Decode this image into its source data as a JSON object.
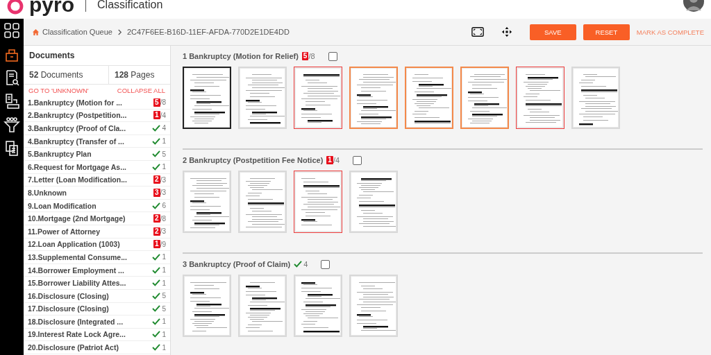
{
  "header": {
    "logo": "pyro",
    "title": "Classification"
  },
  "nav": [
    {
      "selected": false
    },
    {
      "selected": true
    },
    {
      "selected": false
    },
    {
      "selected": false
    },
    {
      "selected": false
    },
    {
      "selected": false
    }
  ],
  "breadcrumb": {
    "root": "Classification Queue",
    "current": "2C47F6EE-B16D-11EF-AFDA-770D2E1DE4DD"
  },
  "toolbar": {
    "buttons": [
      "SAVE",
      "RESET"
    ],
    "link": "MARK AS COMPLETE"
  },
  "sidebar": {
    "title": "Documents",
    "documents_count": "52",
    "documents_label": "Documents",
    "pages_count": "128",
    "pages_label": "Pages",
    "goto": "GO TO 'UNKNOWN'",
    "collapse": "COLLAPSE ALL",
    "items": [
      {
        "label": "1.Bankruptcy (Motion for ...",
        "kind": "flagged",
        "flag": "5",
        "count": "/8"
      },
      {
        "label": "2.Bankruptcy (Postpetition...",
        "kind": "flagged",
        "flag": "1",
        "count": "/4"
      },
      {
        "label": "3.Bankruptcy (Proof of Cla...",
        "kind": "done",
        "count": "4"
      },
      {
        "label": "4.Bankruptcy (Transfer of ...",
        "kind": "done",
        "count": "1"
      },
      {
        "label": "5.Bankruptcy Plan",
        "kind": "done",
        "count": "5"
      },
      {
        "label": "6.Request for Mortgage As...",
        "kind": "done",
        "count": "1"
      },
      {
        "label": "7.Letter (Loan Modification...",
        "kind": "flagged",
        "flag": "2",
        "count": "/3"
      },
      {
        "label": "8.Unknown",
        "kind": "flagged",
        "flag": "3",
        "count": "/3"
      },
      {
        "label": "9.Loan Modification",
        "kind": "done",
        "count": "6"
      },
      {
        "label": "10.Mortgage (2nd Mortgage)",
        "kind": "flagged",
        "flag": "2",
        "count": "/8"
      },
      {
        "label": "11.Power of Attorney",
        "kind": "flagged",
        "flag": "2",
        "count": "/3"
      },
      {
        "label": "12.Loan Application (1003)",
        "kind": "flagged",
        "flag": "1",
        "count": "/9"
      },
      {
        "label": "13.Supplemental Consume...",
        "kind": "done",
        "count": "1"
      },
      {
        "label": "14.Borrower Employment ...",
        "kind": "done",
        "count": "1"
      },
      {
        "label": "15.Borrower Liability Attes...",
        "kind": "done",
        "count": "1"
      },
      {
        "label": "16.Disclosure (Closing)",
        "kind": "done",
        "count": "5"
      },
      {
        "label": "17.Disclosure (Closing)",
        "kind": "done",
        "count": "5"
      },
      {
        "label": "18.Disclosure (Integrated ...",
        "kind": "done",
        "count": "1"
      },
      {
        "label": "19.Interest Rate Lock Agre...",
        "kind": "done",
        "count": "1"
      },
      {
        "label": "20.Disclosure (Patriot Act)",
        "kind": "done",
        "count": "1"
      }
    ]
  },
  "sections": [
    {
      "title": "1 Bankruptcy (Motion for Relief)",
      "kind": "flagged",
      "flag": "5",
      "count": "/8",
      "checked": false,
      "pages": [
        {
          "kind": "selected"
        },
        {
          "kind": "plain"
        },
        {
          "kind": "error"
        },
        {
          "kind": "warning"
        },
        {
          "kind": "warning"
        },
        {
          "kind": "warning"
        },
        {
          "kind": "error"
        },
        {
          "kind": "plain"
        }
      ]
    },
    {
      "title": "2 Bankruptcy (Postpetition Fee Notice)",
      "kind": "flagged",
      "flag": "1",
      "count": "/4",
      "checked": false,
      "pages": [
        {
          "kind": "plain"
        },
        {
          "kind": "plain"
        },
        {
          "kind": "error"
        },
        {
          "kind": "plain"
        }
      ]
    },
    {
      "title": "3 Bankruptcy (Proof of Claim)",
      "kind": "done",
      "count": "4",
      "checked": false,
      "pages": [
        {
          "kind": "plain"
        },
        {
          "kind": "plain"
        },
        {
          "kind": "plain"
        },
        {
          "kind": "plain"
        }
      ]
    }
  ]
}
